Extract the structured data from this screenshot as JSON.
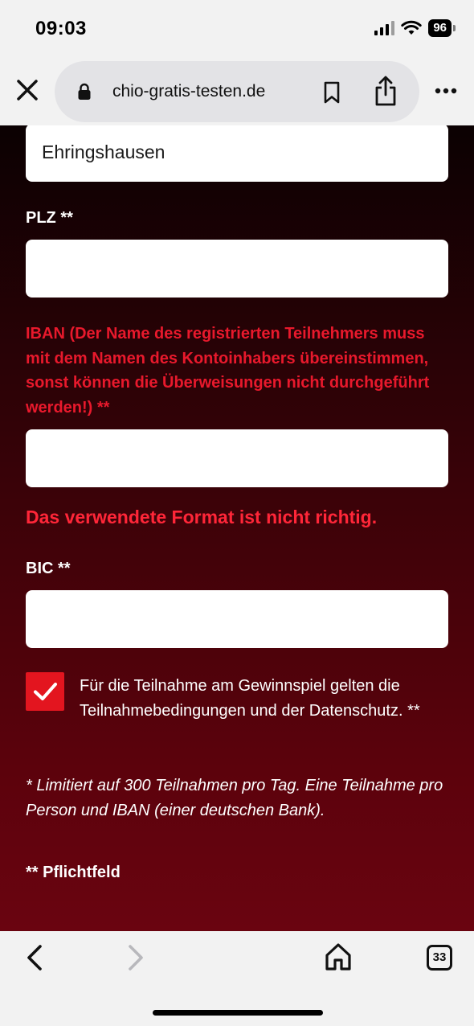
{
  "status_bar": {
    "time": "09:03",
    "battery": "96"
  },
  "browser": {
    "url": "chio-gratis-testen.de",
    "tab_count": "33"
  },
  "form": {
    "ort_value": "Ehringshausen",
    "plz_label": "PLZ **",
    "plz_value": "",
    "iban_label": "IBAN (Der Name des registrierten Teilnehmers muss mit dem Namen des Kontoinhabers übereinstimmen, sonst können die Überweisungen nicht durchgeführt werden!) **",
    "iban_value": "",
    "iban_error": "Das verwendete Format ist nicht richtig.",
    "bic_label": "BIC **",
    "bic_value": "",
    "consent_checked": true,
    "consent_text": "Für die Teilnahme am Gewinnspiel gelten die Teilnahmebedingungen und der Datenschutz.  **",
    "note": "* Limitiert auf 300 Teilnahmen pro Tag. Eine Teilnahme pro Person und IBAN (einer deutschen Bank).",
    "required_note": "** Pflichtfeld"
  },
  "colors": {
    "error": "#e8192c",
    "checkbox": "#e3151f",
    "gradient_top": "#0b0102",
    "gradient_bottom": "#6a0410"
  }
}
